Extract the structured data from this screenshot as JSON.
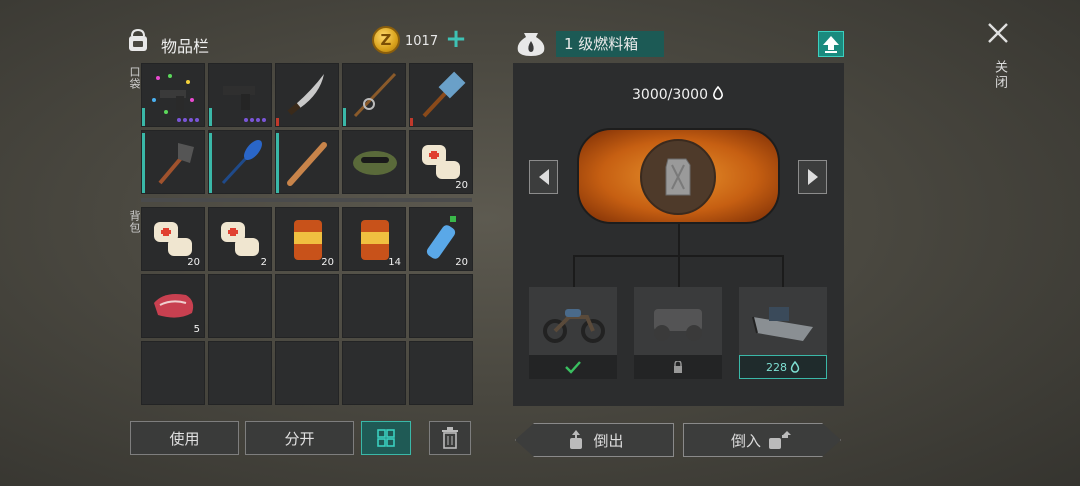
{
  "inventory": {
    "title": "物品栏",
    "coins": "1017",
    "pocket_label": "口袋",
    "backpack_label": "背包",
    "pocket_items": [
      {
        "name": "party-pistol",
        "count": ""
      },
      {
        "name": "pistol",
        "count": ""
      },
      {
        "name": "machete",
        "count": ""
      },
      {
        "name": "fishing-rod",
        "count": ""
      },
      {
        "name": "sledgehammer",
        "count": ""
      },
      {
        "name": "shovel",
        "count": ""
      },
      {
        "name": "paddle",
        "count": ""
      },
      {
        "name": "baseball-bat",
        "count": ""
      },
      {
        "name": "military-cap",
        "count": ""
      },
      {
        "name": "bandage",
        "count": "20"
      }
    ],
    "backpack_items": [
      {
        "name": "bandage",
        "count": "20"
      },
      {
        "name": "bandage",
        "count": "2"
      },
      {
        "name": "canned-food",
        "count": "20"
      },
      {
        "name": "canned-food",
        "count": "14"
      },
      {
        "name": "water-bottle",
        "count": "20"
      },
      {
        "name": "raw-meat",
        "count": "5"
      }
    ],
    "buttons": {
      "use": "使用",
      "split": "分开"
    }
  },
  "fuel_box": {
    "title": "1 级燃料箱",
    "capacity": "3000/3000",
    "vehicles": [
      {
        "name": "motorcycle",
        "status": "selected"
      },
      {
        "name": "atv",
        "status": "locked"
      },
      {
        "name": "boat",
        "status": "228"
      }
    ],
    "pour_out": "倒出",
    "pour_in": "倒入"
  },
  "close_label": "关闭",
  "colors": {
    "accent": "#3ab8a8",
    "tank_orange": "#d8741c"
  }
}
